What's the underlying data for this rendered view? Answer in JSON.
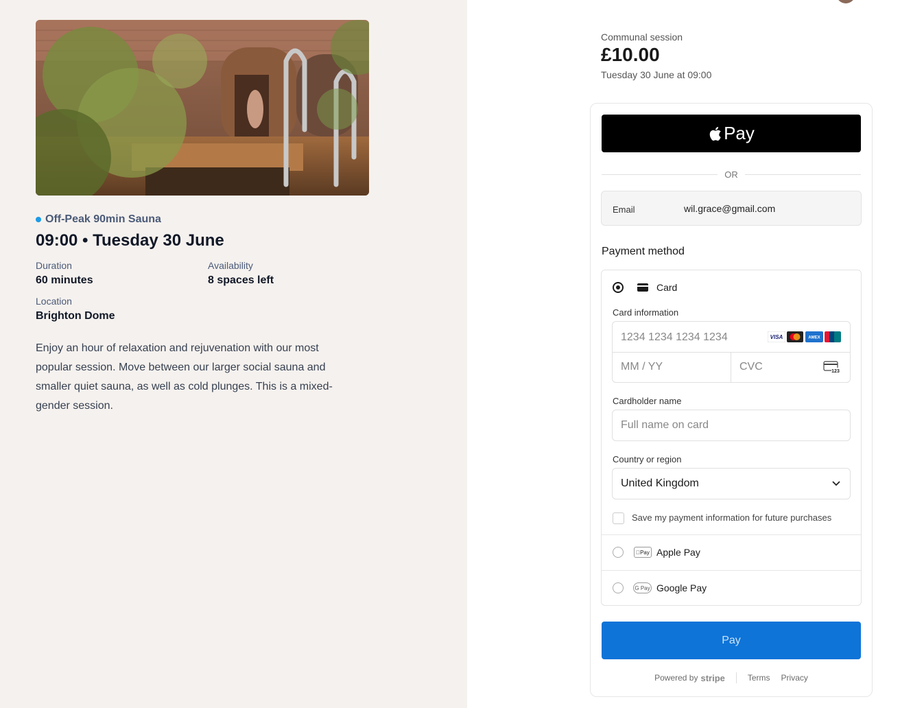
{
  "event": {
    "session_type": "Off-Peak 90min Sauna",
    "title": "09:00 • Tuesday 30 June",
    "duration_label": "Duration",
    "duration_value": "60 minutes",
    "availability_label": "Availability",
    "availability_value": "8 spaces left",
    "location_label": "Location",
    "location_value": "Brighton Dome",
    "description": "Enjoy an hour of relaxation and rejuvenation with our most popular session. Move between our larger social sauna and smaller quiet sauna, as well as cold plunges. This is a mixed-gender session."
  },
  "summary": {
    "label": "Communal session",
    "price": "£10.00",
    "date": "Tuesday 30 June at 09:00"
  },
  "checkout": {
    "apple_pay_button": "Pay",
    "or_text": "OR",
    "email_label": "Email",
    "email_value": "wil.grace@gmail.com",
    "payment_method_title": "Payment method",
    "card_option_label": "Card",
    "card_info_label": "Card information",
    "card_number_placeholder": "1234 1234 1234 1234",
    "expiry_placeholder": "MM / YY",
    "cvc_placeholder": "CVC",
    "cardholder_label": "Cardholder name",
    "cardholder_placeholder": "Full name on card",
    "country_label": "Country or region",
    "country_value": "United Kingdom",
    "save_info_label": "Save my payment information for future purchases",
    "apple_pay_option_label": "Apple Pay",
    "google_pay_option_label": "Google Pay",
    "pay_button": "Pay",
    "selected_method": "Card"
  },
  "card_brands": [
    "VISA",
    "mastercard",
    "AMEX",
    "UnionPay"
  ],
  "footer": {
    "powered_by": "Powered by",
    "brand": "stripe",
    "terms": "Terms",
    "privacy": "Privacy"
  },
  "colors": {
    "accent_blue": "#0e74d8",
    "session_dot": "#1a9be8",
    "left_panel_bg": "#f5f1ee"
  }
}
